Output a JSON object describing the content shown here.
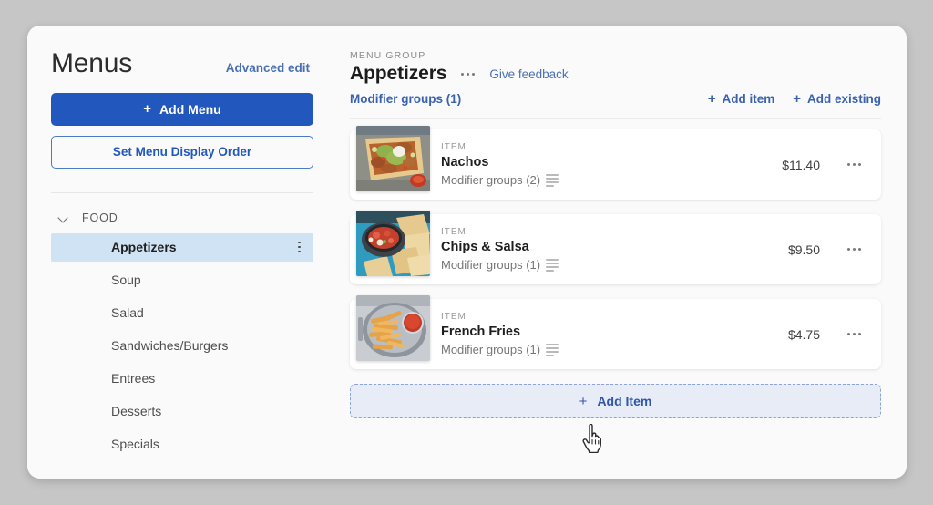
{
  "sidebar": {
    "title": "Menus",
    "advanced_edit_label": "Advanced edit",
    "add_menu_label": "Add Menu",
    "add_menu_plus": "+",
    "set_order_label": "Set Menu Display Order",
    "group": {
      "label": "FOOD",
      "chevron_icon": "chevron-down-icon",
      "expanded": true
    },
    "items": [
      {
        "label": "Appetizers",
        "active": true,
        "kebab_icon": "kebab-vertical-icon"
      },
      {
        "label": "Soup",
        "active": false
      },
      {
        "label": "Salad",
        "active": false
      },
      {
        "label": "Sandwiches/Burgers",
        "active": false
      },
      {
        "label": "Entrees",
        "active": false
      },
      {
        "label": "Desserts",
        "active": false
      },
      {
        "label": "Specials",
        "active": false
      }
    ]
  },
  "main": {
    "eyebrow": "MENU GROUP",
    "group_title": "Appetizers",
    "group_kebab_icon": "kebab-horizontal-icon",
    "feedback_label": "Give feedback",
    "modifier_groups_label": "Modifier groups (1)",
    "add_item_label": "Add item",
    "add_existing_label": "Add existing",
    "plus_glyph": "+",
    "items": [
      {
        "eyebrow": "ITEM",
        "name": "Nachos",
        "modifiers": "Modifier groups (2)",
        "price": "$11.40",
        "thumb": "nachos",
        "list_icon": "list-lines-icon",
        "kebab_icon": "kebab-horizontal-icon"
      },
      {
        "eyebrow": "ITEM",
        "name": "Chips & Salsa",
        "modifiers": "Modifier groups (1)",
        "price": "$9.50",
        "thumb": "chips-salsa",
        "list_icon": "list-lines-icon",
        "kebab_icon": "kebab-horizontal-icon"
      },
      {
        "eyebrow": "ITEM",
        "name": "French Fries",
        "modifiers": "Modifier groups (1)",
        "price": "$4.75",
        "thumb": "french-fries",
        "list_icon": "list-lines-icon",
        "kebab_icon": "kebab-horizontal-icon"
      }
    ],
    "add_item_button_label": "Add Item"
  },
  "cursor": {
    "type": "pointer-hand"
  },
  "colors": {
    "primary_blue": "#2258bd",
    "link_blue": "#3a62ad",
    "muted_link_blue": "#4a6fb5",
    "active_nav_bg": "#cfe3f5",
    "dashed_bg": "#e8ecf7",
    "dashed_border": "#8da3d6",
    "page_bg": "#c6c6c6",
    "card_bg": "#fafafa"
  }
}
